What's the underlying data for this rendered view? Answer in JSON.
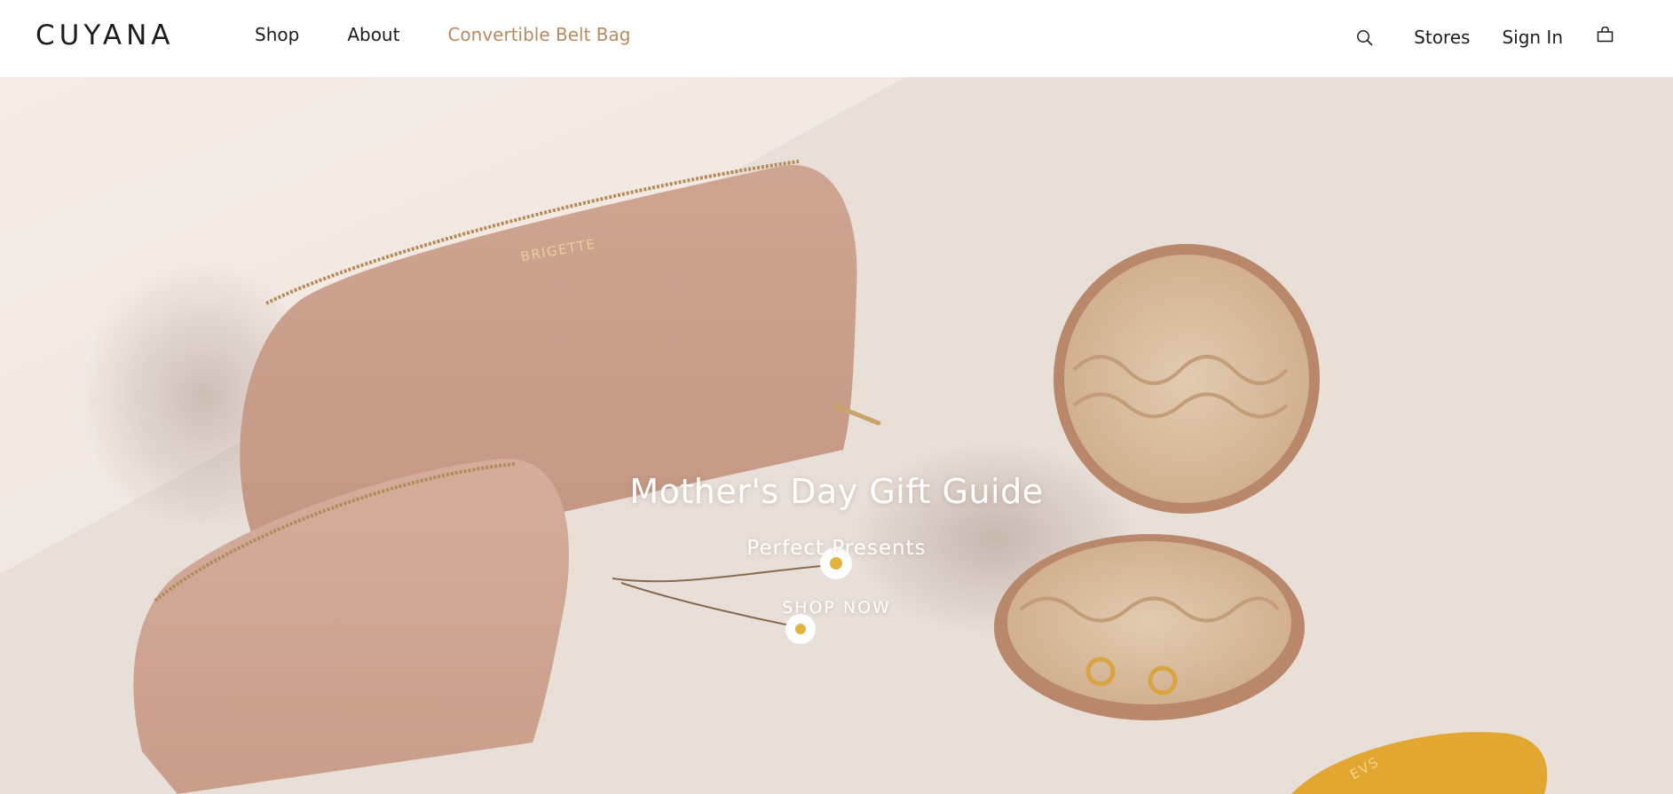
{
  "header": {
    "logo": "CUYANA",
    "nav": [
      {
        "label": "Shop"
      },
      {
        "label": "About"
      },
      {
        "label": "Convertible Belt Bag"
      }
    ],
    "accent_color": "#b88a62",
    "utility": {
      "search_icon": "search-icon",
      "stores_label": "Stores",
      "signin_label": "Sign In",
      "bag_icon": "shopping-bag-icon"
    }
  },
  "hero": {
    "title": "Mother's Day Gift Guide",
    "subtitle": "Perfect Presents",
    "cta_label": "SHOP NOW",
    "pouch_monogram": "BRIGETTE",
    "tray_monogram": "EVS",
    "colors": {
      "pouch": "#c99f8a",
      "jewelry_case_interior": "#dcc1a2",
      "tray": "#e3a932"
    }
  }
}
